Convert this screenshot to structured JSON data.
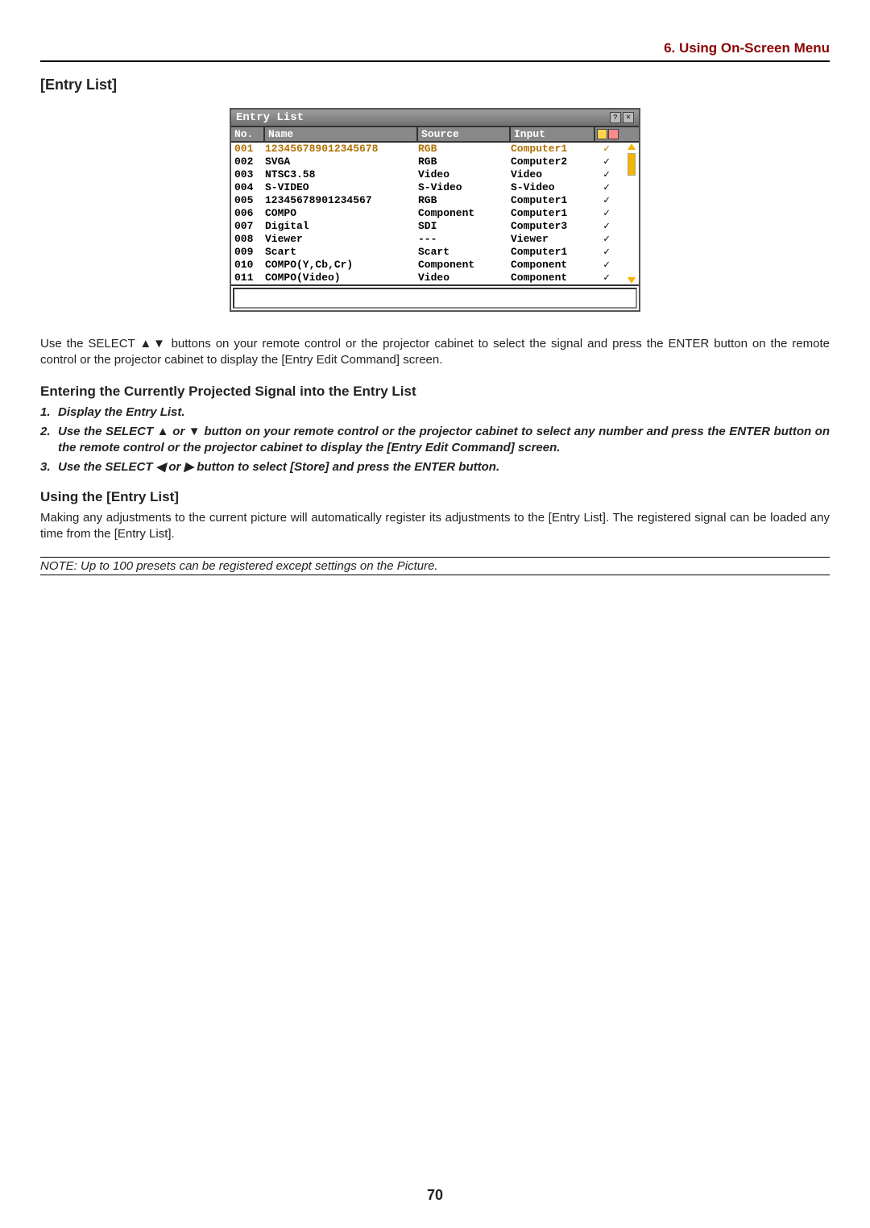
{
  "page": {
    "section_header": "6. Using On-Screen Menu",
    "title": "[Entry List]",
    "page_number": "70"
  },
  "window": {
    "title": "Entry List",
    "headers": {
      "no": "No.",
      "name": "Name",
      "source": "Source",
      "input": "Input"
    },
    "rows": [
      {
        "no": "001",
        "name": "123456789012345678",
        "source": "RGB",
        "input": "Computer1",
        "chk": true,
        "selected": true
      },
      {
        "no": "002",
        "name": "SVGA",
        "source": "RGB",
        "input": "Computer2",
        "chk": true,
        "selected": false
      },
      {
        "no": "003",
        "name": "NTSC3.58",
        "source": "Video",
        "input": "Video",
        "chk": true,
        "selected": false
      },
      {
        "no": "004",
        "name": "S-VIDEO",
        "source": "S-Video",
        "input": "S-Video",
        "chk": true,
        "selected": false
      },
      {
        "no": "005",
        "name": "12345678901234567",
        "source": "RGB",
        "input": "Computer1",
        "chk": true,
        "selected": false
      },
      {
        "no": "006",
        "name": "COMPO",
        "source": "Component",
        "input": "Computer1",
        "chk": true,
        "selected": false
      },
      {
        "no": "007",
        "name": "Digital",
        "source": "SDI",
        "input": "Computer3",
        "chk": true,
        "selected": false
      },
      {
        "no": "008",
        "name": "Viewer",
        "source": "---",
        "input": "Viewer",
        "chk": true,
        "selected": false
      },
      {
        "no": "009",
        "name": "Scart",
        "source": "Scart",
        "input": "Computer1",
        "chk": true,
        "selected": false
      },
      {
        "no": "010",
        "name": "COMPO(Y,Cb,Cr)",
        "source": "Component",
        "input": "Component",
        "chk": true,
        "selected": false
      },
      {
        "no": "011",
        "name": "COMPO(Video)",
        "source": "Video",
        "input": "Component",
        "chk": true,
        "selected": false
      }
    ]
  },
  "text": {
    "para1": "Use the SELECT ▲▼ buttons on your remote control or the projector cabinet to select the signal and press the ENTER button on the remote control or the projector cabinet to display the [Entry Edit Command] screen.",
    "sub1": "Entering the Currently Projected Signal into the Entry List",
    "steps": [
      "Display the Entry List.",
      "Use the SELECT ▲ or ▼ button on your remote control or the projector cabinet to select any number and press the ENTER button on the remote control or the projector cabinet to display the [Entry Edit Command] screen.",
      "Use the SELECT ◀ or ▶ button to select [Store] and press the ENTER button."
    ],
    "sub2": "Using the [Entry List]",
    "para2": "Making any adjustments to the current picture will automatically register its adjustments to the [Entry List]. The registered signal can be loaded any time from the [Entry List].",
    "note": "NOTE: Up to 100 presets can be registered except settings on the Picture."
  }
}
